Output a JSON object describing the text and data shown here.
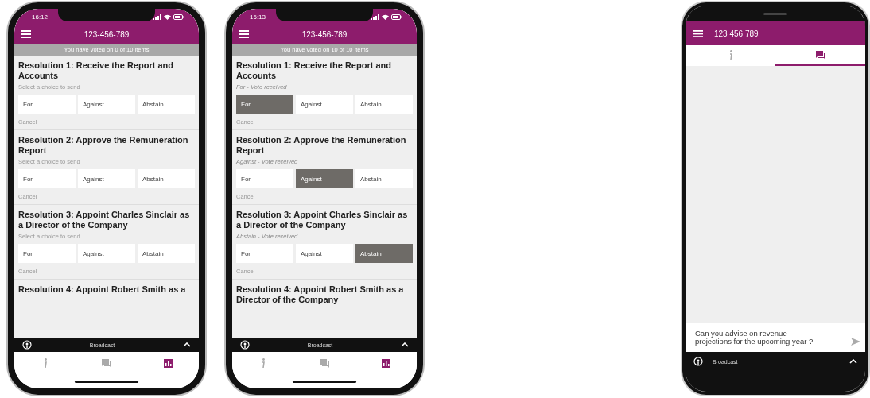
{
  "phones": [
    {
      "kind": "voting",
      "status_time": "16:12",
      "title": "123-456-789",
      "banner": "You have voted on 0 of 10 items",
      "resolutions": [
        {
          "title": "Resolution 1: Receive the Report and Accounts",
          "status": "Select a choice to send",
          "received": false,
          "choices": [
            {
              "label": "For",
              "selected": false
            },
            {
              "label": "Against",
              "selected": false
            },
            {
              "label": "Abstain",
              "selected": false
            }
          ],
          "cancel": "Cancel"
        },
        {
          "title": "Resolution 2: Approve the Remuneration Report",
          "status": "Select a choice to send",
          "received": false,
          "choices": [
            {
              "label": "For",
              "selected": false
            },
            {
              "label": "Against",
              "selected": false
            },
            {
              "label": "Abstain",
              "selected": false
            }
          ],
          "cancel": "Cancel"
        },
        {
          "title": "Resolution 3: Appoint Charles Sinclair as a Director of the Company",
          "status": "Select a choice to send",
          "received": false,
          "choices": [
            {
              "label": "For",
              "selected": false
            },
            {
              "label": "Against",
              "selected": false
            },
            {
              "label": "Abstain",
              "selected": false
            }
          ],
          "cancel": "Cancel"
        }
      ],
      "next_title": "Resolution 4: Appoint Robert Smith as a",
      "broadcast": "Broadcast",
      "nav_tabs": [
        {
          "kind": "info",
          "selected": false
        },
        {
          "kind": "chat",
          "selected": false
        },
        {
          "kind": "vote",
          "selected": true
        }
      ]
    },
    {
      "kind": "voting",
      "status_time": "16:13",
      "title": "123-456-789",
      "banner": "You have voted on 10 of 10 items",
      "resolutions": [
        {
          "title": "Resolution 1: Receive the Report and Accounts",
          "status": "For - Vote received",
          "received": true,
          "choices": [
            {
              "label": "For",
              "selected": true
            },
            {
              "label": "Against",
              "selected": false
            },
            {
              "label": "Abstain",
              "selected": false
            }
          ],
          "cancel": "Cancel"
        },
        {
          "title": "Resolution 2: Approve the Remuneration Report",
          "status": "Against - Vote received",
          "received": true,
          "choices": [
            {
              "label": "For",
              "selected": false
            },
            {
              "label": "Against",
              "selected": true
            },
            {
              "label": "Abstain",
              "selected": false
            }
          ],
          "cancel": "Cancel"
        },
        {
          "title": "Resolution 3: Appoint Charles Sinclair as a Director of the Company",
          "status": "Abstain - Vote received",
          "received": true,
          "choices": [
            {
              "label": "For",
              "selected": false
            },
            {
              "label": "Against",
              "selected": false
            },
            {
              "label": "Abstain",
              "selected": true
            }
          ],
          "cancel": "Cancel"
        }
      ],
      "next_title": "Resolution 4: Appoint Robert Smith as a Director of the Company",
      "broadcast": "Broadcast",
      "nav_tabs": [
        {
          "kind": "info",
          "selected": false
        },
        {
          "kind": "chat",
          "selected": false
        },
        {
          "kind": "vote",
          "selected": true
        }
      ]
    },
    {
      "kind": "chat",
      "title": "123 456 789",
      "tabs": [
        {
          "kind": "info",
          "selected": false
        },
        {
          "kind": "chat",
          "selected": true
        }
      ],
      "message": "Can you advise on revenue projections for the upcoming year ?",
      "broadcast": "Broadcast"
    }
  ]
}
